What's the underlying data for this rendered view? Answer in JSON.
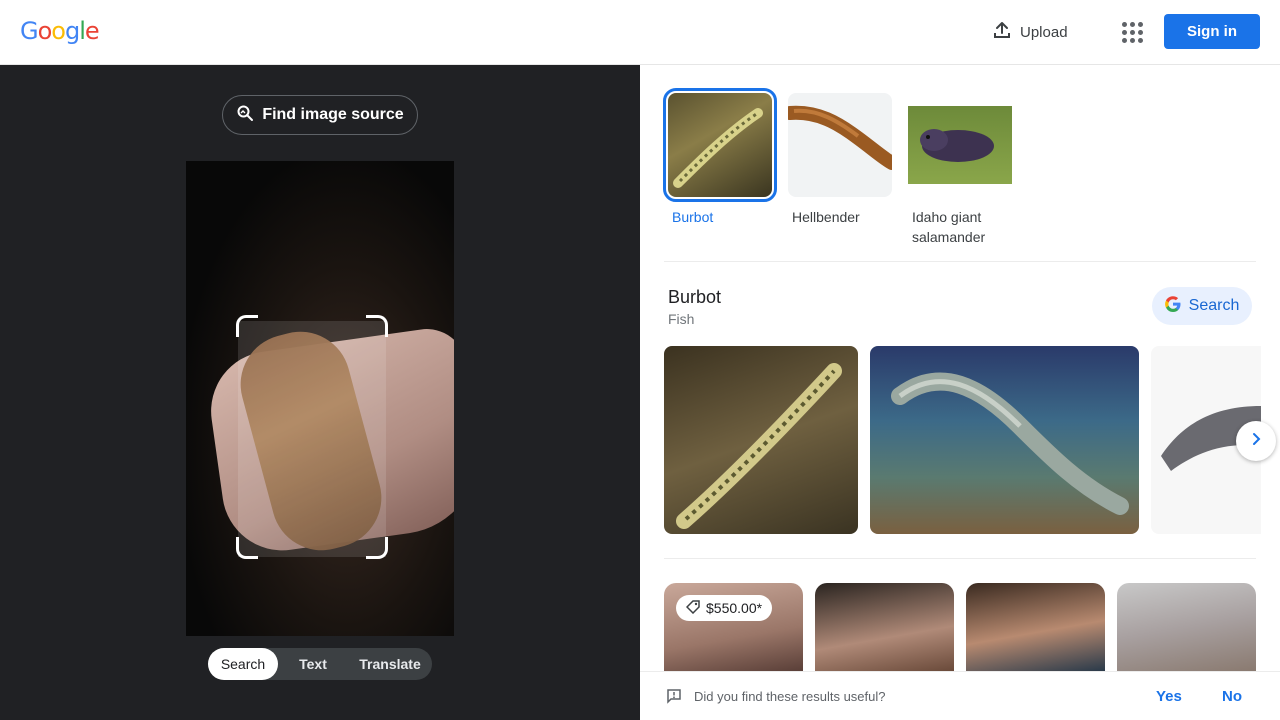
{
  "header": {
    "logo_letters": [
      "G",
      "o",
      "o",
      "g",
      "l",
      "e"
    ],
    "logo_colors": [
      "#4285F4",
      "#EA4335",
      "#FBBC05",
      "#4285F4",
      "#34A853",
      "#EA4335"
    ],
    "upload_label": "Upload",
    "apps_icon": "apps-grid-icon",
    "signin_label": "Sign in",
    "accent_color": "#1a73e8"
  },
  "left": {
    "find_source_label": "Find image source",
    "modes": [
      "Search",
      "Text",
      "Translate"
    ],
    "active_mode": "Search"
  },
  "candidates": [
    {
      "label": "Burbot",
      "selected": true
    },
    {
      "label": "Hellbender",
      "selected": false
    },
    {
      "label": "Idaho giant salamander",
      "selected": false
    }
  ],
  "entity": {
    "title": "Burbot",
    "subtitle": "Fish",
    "search_label": "Search"
  },
  "products": {
    "first_price": "$550.00*"
  },
  "feedback": {
    "question": "Did you find these results useful?",
    "yes": "Yes",
    "no": "No"
  }
}
